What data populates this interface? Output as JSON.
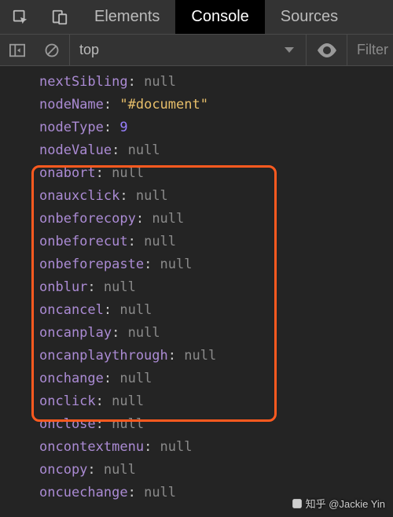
{
  "tabs": {
    "elements": "Elements",
    "console": "Console",
    "sources": "Sources",
    "active": "console"
  },
  "toolbar": {
    "context": "top",
    "filter_placeholder": "Filter"
  },
  "props": [
    {
      "key": "nextSibling",
      "type": "null",
      "val": "null"
    },
    {
      "key": "nodeName",
      "type": "str",
      "val": "\"#document\""
    },
    {
      "key": "nodeType",
      "type": "num",
      "val": "9"
    },
    {
      "key": "nodeValue",
      "type": "null",
      "val": "null"
    },
    {
      "key": "onabort",
      "type": "null",
      "val": "null"
    },
    {
      "key": "onauxclick",
      "type": "null",
      "val": "null"
    },
    {
      "key": "onbeforecopy",
      "type": "null",
      "val": "null"
    },
    {
      "key": "onbeforecut",
      "type": "null",
      "val": "null"
    },
    {
      "key": "onbeforepaste",
      "type": "null",
      "val": "null"
    },
    {
      "key": "onblur",
      "type": "null",
      "val": "null"
    },
    {
      "key": "oncancel",
      "type": "null",
      "val": "null"
    },
    {
      "key": "oncanplay",
      "type": "null",
      "val": "null"
    },
    {
      "key": "oncanplaythrough",
      "type": "null",
      "val": "null"
    },
    {
      "key": "onchange",
      "type": "null",
      "val": "null"
    },
    {
      "key": "onclick",
      "type": "null",
      "val": "null"
    },
    {
      "key": "onclose",
      "type": "null",
      "val": "null"
    },
    {
      "key": "oncontextmenu",
      "type": "null",
      "val": "null"
    },
    {
      "key": "oncopy",
      "type": "null",
      "val": "null"
    },
    {
      "key": "oncuechange",
      "type": "null",
      "val": "null"
    }
  ],
  "watermark": "知乎 @Jackie Yin"
}
